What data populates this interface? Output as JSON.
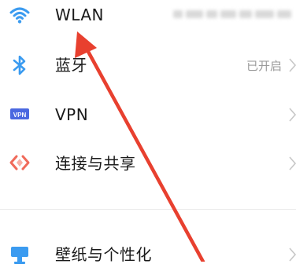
{
  "settings": {
    "items": [
      {
        "label": "WLAN",
        "icon": "wifi-icon",
        "status": "",
        "icon_color": "#3b9bf0"
      },
      {
        "label": "蓝牙",
        "icon": "bluetooth-icon",
        "status": "已开启",
        "icon_color": "#3b9bf0"
      },
      {
        "label": "VPN",
        "icon": "vpn-icon",
        "icon_text": "VPN",
        "status": "",
        "icon_color": "#4a68e0"
      },
      {
        "label": "连接与共享",
        "icon": "connection-share-icon",
        "status": "",
        "icon_color": "#f06a5a"
      },
      {
        "label": "壁纸与个性化",
        "icon": "wallpaper-icon",
        "status": "",
        "icon_color": "#3b9bf0"
      }
    ]
  },
  "colors": {
    "annotation_arrow": "#e8402f",
    "status_text": "#9a9a9a",
    "chevron": "#c8c8c8"
  }
}
